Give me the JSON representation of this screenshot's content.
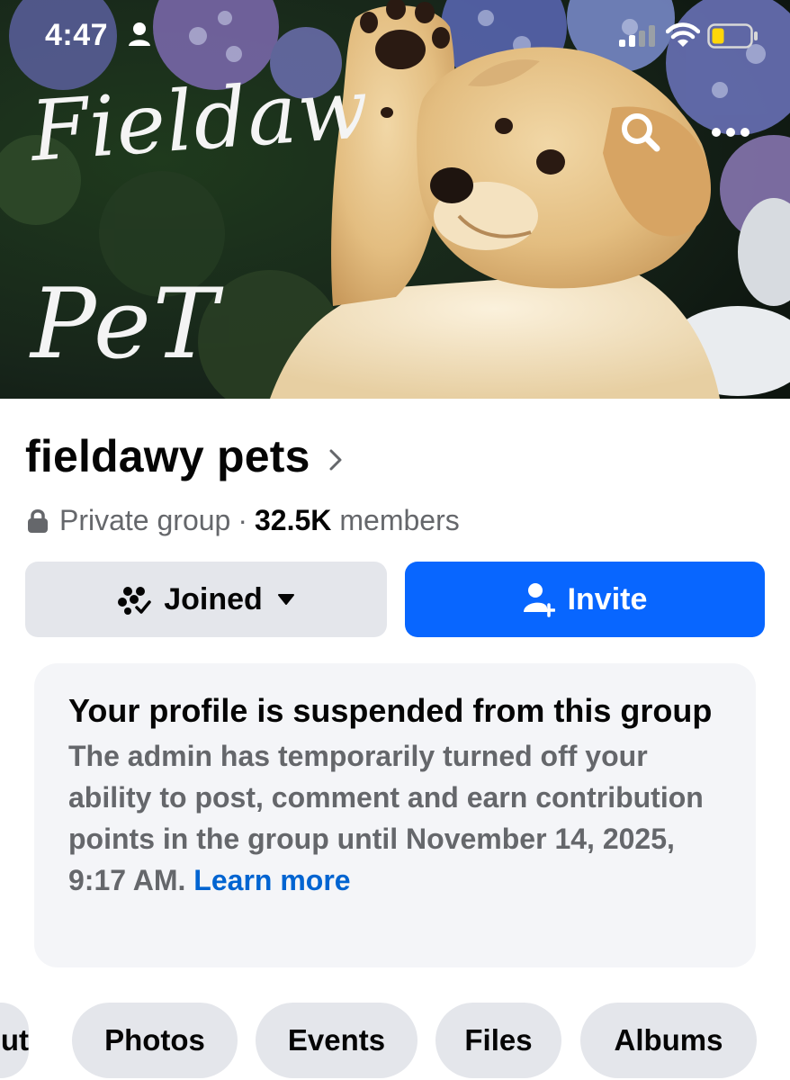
{
  "status_bar": {
    "time": "4:47",
    "icons": [
      "person-icon",
      "signal-icon",
      "wifi-icon",
      "battery-icon"
    ]
  },
  "cover": {
    "text_line_1": "Fieldaw",
    "text_line_2": "PeT",
    "actions": [
      "search-icon",
      "more-icon"
    ]
  },
  "group": {
    "name": "fieldawy pets",
    "privacy": "Private group",
    "separator": "·",
    "member_count": "32.5K",
    "member_label": "members"
  },
  "actions": {
    "joined_label": "Joined",
    "invite_label": "Invite"
  },
  "notice": {
    "title": "Your profile is suspended from this group",
    "body": "The admin has temporarily turned off your ability to post, comment and earn contribution points in the group until November 14, 2025, 9:17 AM.",
    "link": "Learn more"
  },
  "tabs": [
    {
      "label": "ut"
    },
    {
      "label": "Photos"
    },
    {
      "label": "Events"
    },
    {
      "label": "Files"
    },
    {
      "label": "Albums"
    }
  ],
  "colors": {
    "primary": "#0866ff",
    "link": "#0064d1",
    "secondary_button": "#e4e6eb",
    "secondary_text": "#65676b",
    "notice_bg": "#f4f5f8",
    "battery_low": "#ffd60a"
  }
}
